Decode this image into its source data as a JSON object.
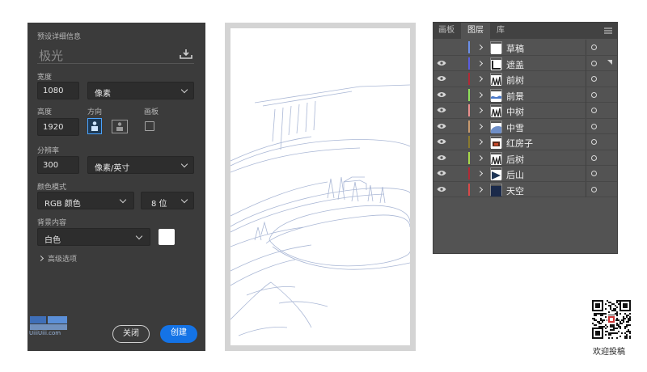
{
  "dialog": {
    "section_title": "预设详细信息",
    "doc_name": "极光",
    "width_label": "宽度",
    "width_value": "1080",
    "width_unit": "像素",
    "height_label": "高度",
    "height_value": "1920",
    "orientation_label": "方向",
    "artboard_label": "画板",
    "resolution_label": "分辨率",
    "resolution_value": "300",
    "resolution_unit": "像素/英寸",
    "color_mode_label": "颜色模式",
    "color_mode_value": "RGB 颜色",
    "bit_depth_value": "8 位",
    "background_label": "背景内容",
    "background_value": "白色",
    "advanced_label": "高级选项",
    "close_button": "关闭",
    "create_button": "创建"
  },
  "panel": {
    "tabs": [
      "画板",
      "图层",
      "库"
    ],
    "active_tab": "图层",
    "layers": [
      {
        "name": "草稿",
        "visible": false,
        "color": "#6b8fe8",
        "thumb": "white"
      },
      {
        "name": "遮盖",
        "visible": true,
        "color": "#5a5de0",
        "thumb": "mask"
      },
      {
        "name": "前树",
        "visible": true,
        "color": "#b02a36",
        "thumb": "trees"
      },
      {
        "name": "前景",
        "visible": true,
        "color": "#8fe05a",
        "thumb": "fore"
      },
      {
        "name": "中树",
        "visible": true,
        "color": "#e9908e",
        "thumb": "trees"
      },
      {
        "name": "中雪",
        "visible": true,
        "color": "#c89a6e",
        "thumb": "snow"
      },
      {
        "name": "红房子",
        "visible": true,
        "color": "#8a7a2e",
        "thumb": "house"
      },
      {
        "name": "后树",
        "visible": true,
        "color": "#a8d84a",
        "thumb": "trees"
      },
      {
        "name": "后山",
        "visible": true,
        "color": "#b02a36",
        "thumb": "mountain"
      },
      {
        "name": "天空",
        "visible": true,
        "color": "#d94a4a",
        "thumb": "sky"
      }
    ]
  },
  "watermark_text": "UiiiUiii.com",
  "qr_caption": "欢迎投稿"
}
